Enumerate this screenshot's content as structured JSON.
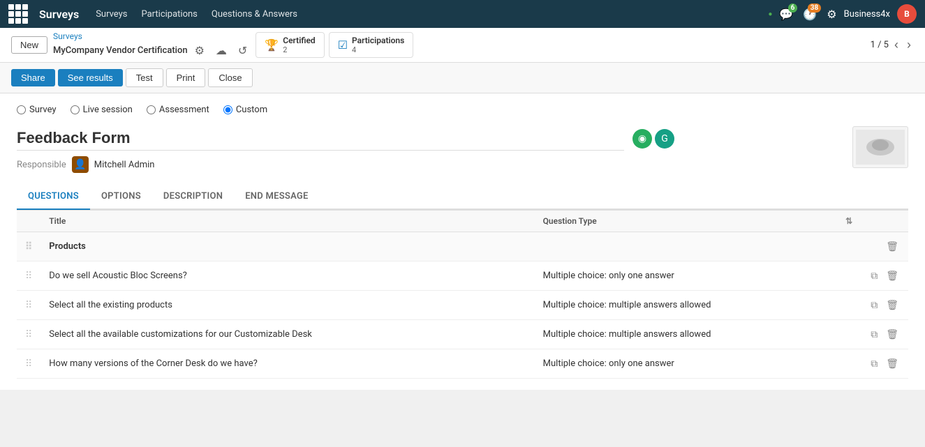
{
  "app": {
    "brand": "Surveys",
    "nav_links": [
      "Surveys",
      "Participations",
      "Questions & Answers"
    ]
  },
  "topbar": {
    "badge_messages": "6",
    "badge_activity": "38",
    "user": "Business4x"
  },
  "breadcrumb": {
    "new_label": "New",
    "parent": "Surveys",
    "title": "MyCompany Vendor Certification",
    "certified_label": "Certified",
    "certified_count": "2",
    "participations_label": "Participations",
    "participations_count": "4",
    "pagination": "1 / 5"
  },
  "toolbar": {
    "share": "Share",
    "see_results": "See results",
    "test": "Test",
    "print": "Print",
    "close": "Close"
  },
  "survey_types": [
    {
      "id": "survey",
      "label": "Survey"
    },
    {
      "id": "live_session",
      "label": "Live session"
    },
    {
      "id": "assessment",
      "label": "Assessment"
    },
    {
      "id": "custom",
      "label": "Custom",
      "checked": true
    }
  ],
  "form": {
    "title": "Feedback Form",
    "responsible_label": "Responsible",
    "responsible_name": "Mitchell Admin"
  },
  "tabs": [
    {
      "id": "questions",
      "label": "QUESTIONS",
      "active": true
    },
    {
      "id": "options",
      "label": "OPTIONS"
    },
    {
      "id": "description",
      "label": "DESCRIPTION"
    },
    {
      "id": "end_message",
      "label": "END MESSAGE"
    }
  ],
  "table": {
    "col_title": "Title",
    "col_question_type": "Question Type",
    "rows": [
      {
        "type": "section",
        "title": "Products",
        "question_type": ""
      },
      {
        "type": "question",
        "title": "Do we sell Acoustic Bloc Screens?",
        "question_type": "Multiple choice: only one answer"
      },
      {
        "type": "question",
        "title": "Select all the existing products",
        "question_type": "Multiple choice: multiple answers allowed"
      },
      {
        "type": "question",
        "title": "Select all the available customizations for our Customizable Desk",
        "question_type": "Multiple choice: multiple answers allowed"
      },
      {
        "type": "question",
        "title": "How many versions of the Corner Desk do we have?",
        "question_type": "Multiple choice: only one answer"
      }
    ]
  }
}
